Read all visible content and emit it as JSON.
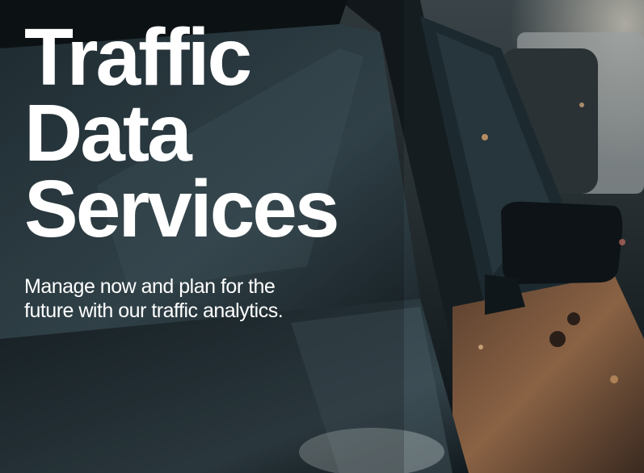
{
  "hero": {
    "title_lines": [
      "Traffic",
      "Data",
      "Services"
    ],
    "subtitle_lines": [
      "Manage now and plan for the",
      "future with our traffic analytics."
    ]
  },
  "image": {
    "description_icon": "car-traffic-photo",
    "colors": {
      "background": "#0e1418",
      "car_body": "#1f2b31",
      "window": "#2a3c44",
      "highlight": "#d9a36a",
      "text": "#ffffff"
    }
  }
}
